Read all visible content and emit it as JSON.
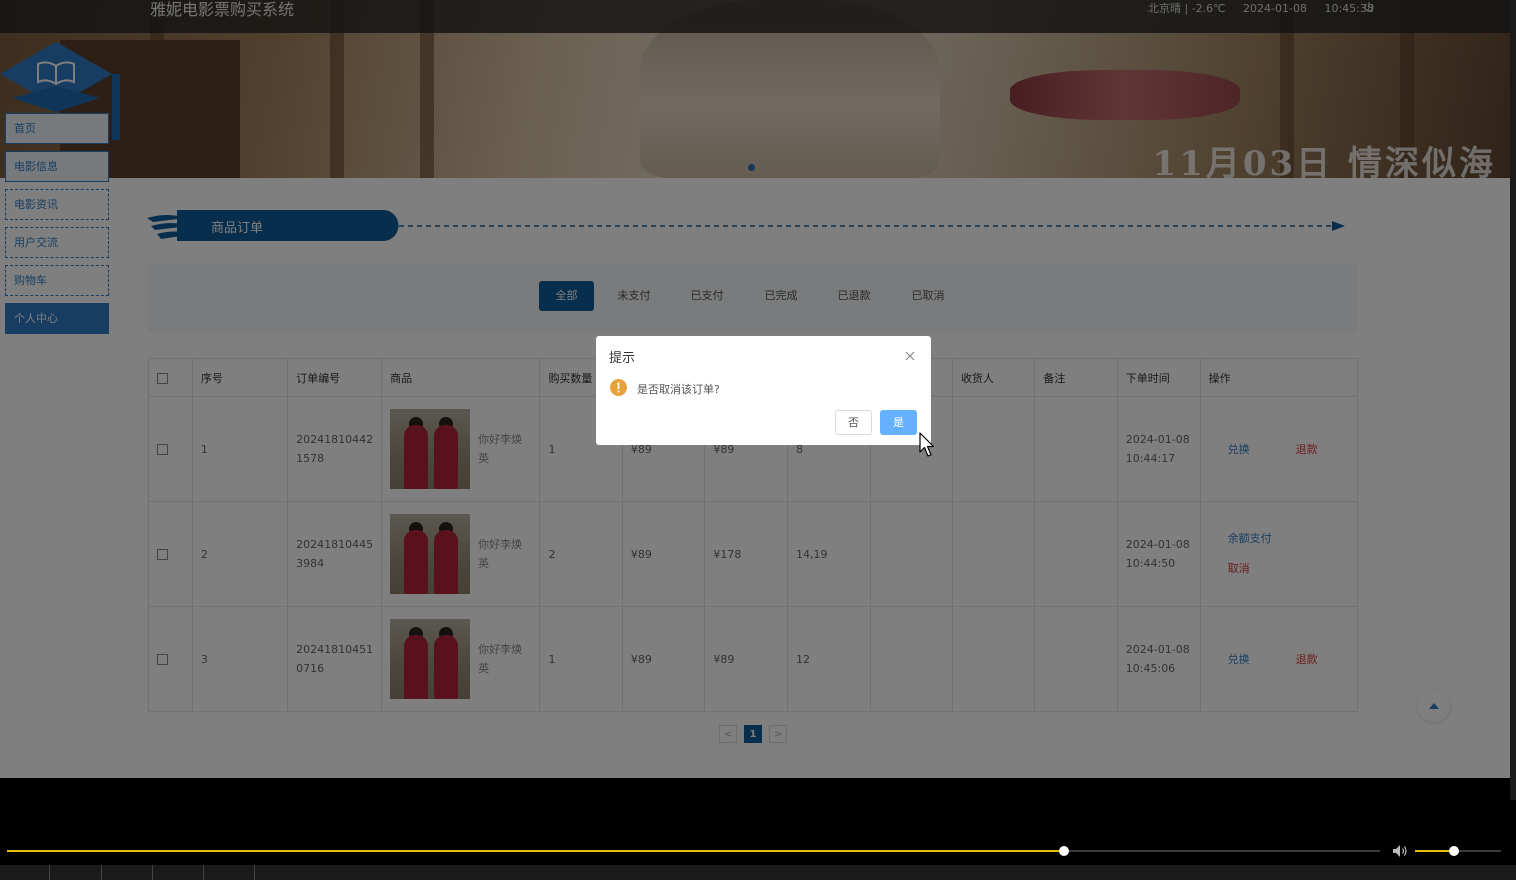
{
  "header": {
    "site_title": "雅妮电影票购买系统",
    "weather": "北京晴 | -2.6℃",
    "date": "2024-01-08",
    "time": "10:45:38"
  },
  "banner": {
    "caption": "11月03日 情深似海"
  },
  "nav": {
    "items": [
      {
        "label": "首页"
      },
      {
        "label": "电影信息"
      },
      {
        "label": "电影资讯"
      },
      {
        "label": "用户交流"
      },
      {
        "label": "购物车"
      },
      {
        "label": "个人中心"
      }
    ]
  },
  "section": {
    "title": "商品订单"
  },
  "tabs": [
    "全部",
    "未支付",
    "已支付",
    "已完成",
    "已退款",
    "已取消"
  ],
  "active_tab": "全部",
  "table": {
    "headers": [
      "",
      "序号",
      "订单编号",
      "商品",
      "购买数量",
      "",
      "",
      "",
      "",
      "收货人",
      "备注",
      "下单时间",
      "操作"
    ],
    "rows": [
      {
        "index": "1",
        "order_no": [
          "20241810442",
          "1578"
        ],
        "product": [
          "你好李焕",
          "英"
        ],
        "quantity": "1",
        "price": "¥89",
        "total": "¥89",
        "seat": "8",
        "recipient": "",
        "note": "",
        "time": [
          "2024-01-08",
          "10:44:17"
        ],
        "actions": [
          "兑换",
          "退款"
        ]
      },
      {
        "index": "2",
        "order_no": [
          "20241810445",
          "3984"
        ],
        "product": [
          "你好李焕",
          "英"
        ],
        "quantity": "2",
        "price": "¥89",
        "total": "¥178",
        "seat": "14,19",
        "recipient": "",
        "note": "",
        "time": [
          "2024-01-08",
          "10:44:50"
        ],
        "actions": [
          "余额支付",
          "取消"
        ]
      },
      {
        "index": "3",
        "order_no": [
          "20241810451",
          "0716"
        ],
        "product": [
          "你好李焕",
          "英"
        ],
        "quantity": "1",
        "price": "¥89",
        "total": "¥89",
        "seat": "12",
        "recipient": "",
        "note": "",
        "time": [
          "2024-01-08",
          "10:45:06"
        ],
        "actions": [
          "兑换",
          "退款"
        ]
      }
    ]
  },
  "pagination": {
    "prev": "<",
    "current": "1",
    "next": ">"
  },
  "dialog": {
    "title": "提示",
    "message": "是否取消该订单?",
    "cancel_label": "否",
    "confirm_label": "是"
  },
  "player": {
    "progress": 0.77,
    "volume": 0.45
  },
  "colors": {
    "primary": "#0f5c98",
    "nav_border": "#2e7dc4",
    "danger": "#d93a3a",
    "confirm": "#66b1ff",
    "warning": "#e6a23c",
    "progress": "#e0c000"
  }
}
